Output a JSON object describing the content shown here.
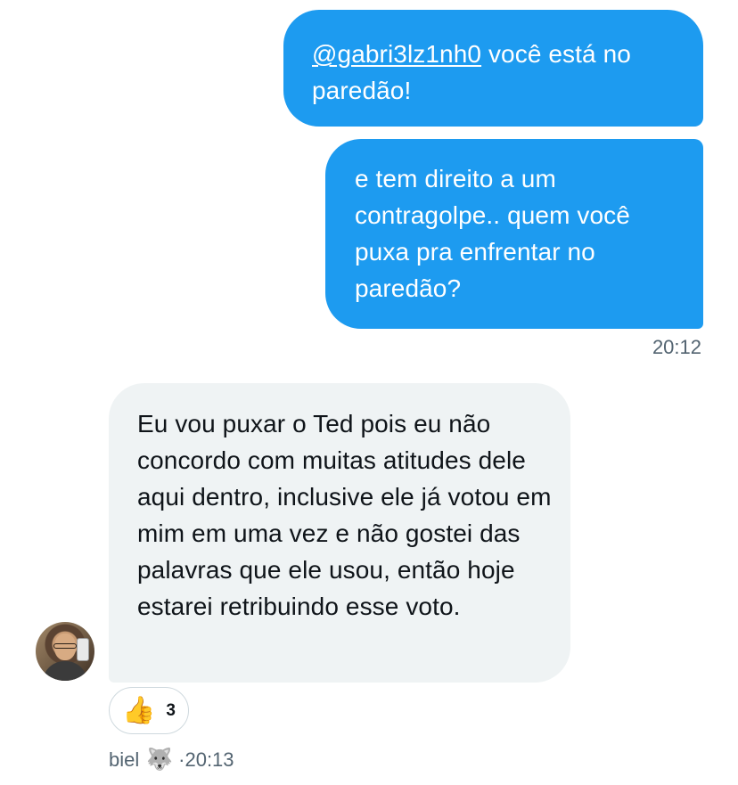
{
  "messages": [
    {
      "direction": "outgoing",
      "mention": "@gabri3lz1nh0",
      "text_after_mention": " você está no paredão!"
    },
    {
      "direction": "outgoing",
      "text": "e tem direito a um contragolpe.. quem você puxa pra enfrentar no paredão?"
    },
    {
      "direction": "incoming",
      "text": "Eu vou puxar o Ted pois eu não concordo com muitas atitudes dele aqui dentro, inclusive ele já votou em mim em uma vez e não gostei das palavras que ele usou, então hoje estarei retribuindo esse voto."
    }
  ],
  "outgoing_time": "20:12",
  "reaction": {
    "emoji": "👍",
    "count": "3"
  },
  "incoming_meta": {
    "sender": "biel",
    "sender_emoji": "🐺",
    "separator": "·",
    "time": "20:13"
  },
  "colors": {
    "outgoing_bubble": "#1d9bf0",
    "incoming_bubble": "#eff3f4",
    "muted_text": "#536471"
  }
}
